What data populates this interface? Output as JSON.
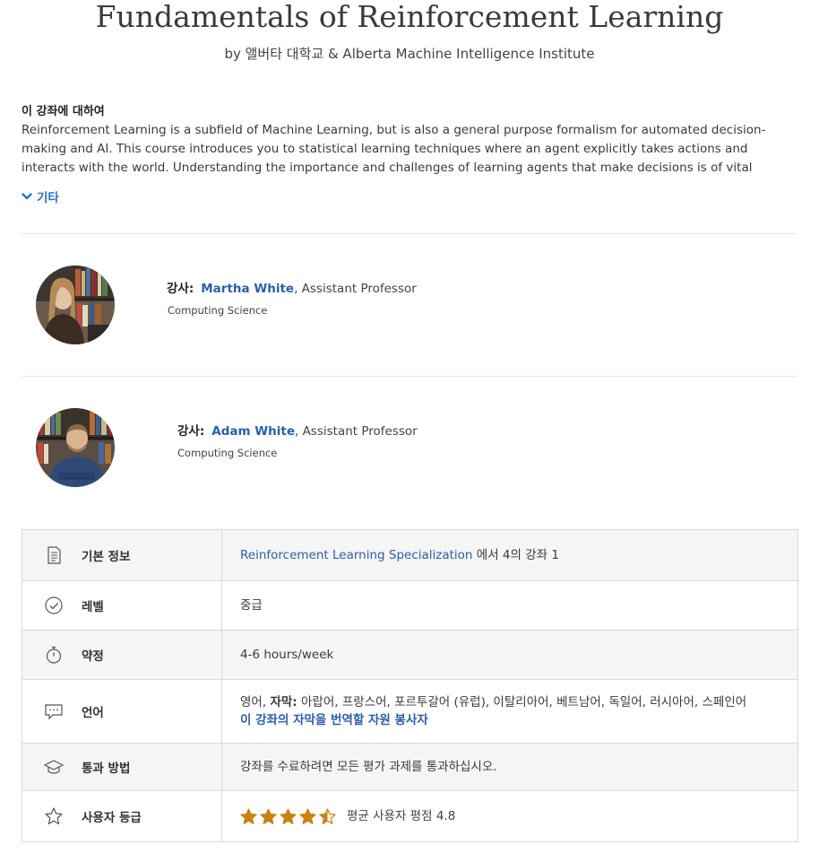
{
  "course": {
    "title": "Fundamentals of Reinforcement Learning",
    "byline": "by 앨버타 대학교 & Alberta Machine Intelligence Institute"
  },
  "about": {
    "heading": "이 강좌에 대하여",
    "text": "Reinforcement Learning is a subfield of Machine Learning, but is also a general purpose formalism for automated decision-making and AI. This course introduces you to statistical learning techniques where an agent explicitly takes actions and interacts with the world. Understanding the importance and challenges of learning agents that make decisions is of vital importance today, with more",
    "more_label": "기타"
  },
  "instructors": [
    {
      "label": "강사:",
      "name": "Martha White",
      "title": ", Assistant Professor",
      "dept": "Computing Science"
    },
    {
      "label": "강사:",
      "name": "Adam White",
      "title": ", Assistant Professor",
      "dept": "Computing Science"
    }
  ],
  "info": {
    "basic": {
      "label": "기본 정보",
      "link": "Reinforcement Learning Specialization",
      "suffix": " 에서 4의 강좌 1"
    },
    "level": {
      "label": "레벨",
      "value": "중급"
    },
    "commitment": {
      "label": "약정",
      "value": "4-6 hours/week"
    },
    "language": {
      "label": "언어",
      "value_prefix": "영어, ",
      "subtitles_label": "자막:",
      "subtitles": " 아랍어, 프랑스어, 포르투갈어 (유럽), 이탈리아어, 베트남어, 독일어, 러시아어, 스페인어",
      "volunteer_link": "이 강좌의 자막을 번역할 자원 봉사자"
    },
    "passing": {
      "label": "통과 방법",
      "value": "강좌를 수료하려면 모든 평가 과제를 통과하십시오."
    },
    "rating": {
      "label": "사용자 등급",
      "stars": 4.5,
      "text": "평균 사용자 평점 4.8"
    }
  },
  "colors": {
    "link": "#2a5fa8",
    "more": "#2a73cc",
    "star": "#c7830e",
    "row_alt": "#f5f5f5"
  }
}
